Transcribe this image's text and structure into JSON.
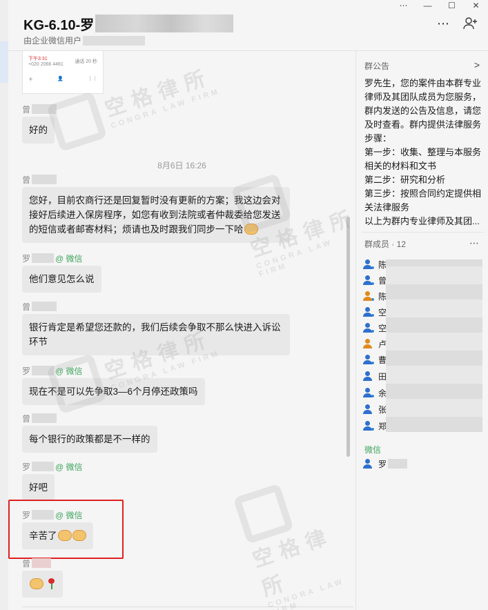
{
  "window": {
    "title": "KG-6.10-罗",
    "subtitle": "由企业微信用户",
    "controls": {
      "more": "⋯",
      "minimize": "—",
      "maximize": "☐",
      "close": "✕"
    }
  },
  "header_icons": {
    "more": "⋯",
    "add_member": "+"
  },
  "chat": {
    "thumbnail": {
      "time": "下午3:31",
      "phone": "+020 2066 4461",
      "duration": "通话 20 秒"
    },
    "date_separator": "8月6日 16:26",
    "messages": [
      {
        "sender": "曾",
        "wechat": "",
        "text": "好的"
      },
      {
        "sender": "曾",
        "wechat": "",
        "text": "您好，目前农商行还是回复暂时没有更新的方案；我这边会对接好后续进入保房程序，如您有收到法院或者仲裁委给您发送的短信或者邮寄材料；烦请也及时跟我们同步一下哈"
      },
      {
        "sender": "罗",
        "wechat": "@ 微信",
        "text": "他们意见怎么说"
      },
      {
        "sender": "曾",
        "wechat": "",
        "text": "银行肯定是希望您还款的，我们后续会争取不那么快进入诉讼环节"
      },
      {
        "sender": "罗",
        "wechat": "@ 微信",
        "text": "现在不是可以先争取3—6个月停还政策吗"
      },
      {
        "sender": "曾",
        "wechat": "",
        "text": "每个银行的政策都是不一样的"
      },
      {
        "sender": "罗",
        "wechat": "@ 微信",
        "text": "好吧"
      },
      {
        "sender": "罗",
        "wechat": "@ 微信",
        "text": "辛苦了"
      },
      {
        "sender": "曾",
        "wechat": "",
        "text": ""
      }
    ]
  },
  "watermark": {
    "cn": "空格律所",
    "en": "CONGRA LAW FIRM"
  },
  "sidebar": {
    "notice_title": "群公告",
    "notice_arrow": ">",
    "notice_text": "罗先生，您的案件由本群专业律师及其团队成员为您服务，群内发送的公告及信息，请您及时查看。群内提供法律服务步骤：\n第一步：收集、整理与本服务相关的材料和文书\n第二步：研究和分析\n第三步：按照合同约定提供相关法律服务\n以上为群内专业律师及其团...",
    "members_title": "群成员 · 12",
    "members_more": "⋯",
    "members": [
      {
        "name": "陈",
        "color": "#2e6fcf"
      },
      {
        "name": "曾",
        "color": "#2e6fcf"
      },
      {
        "name": "陈",
        "color": "#e08a1e"
      },
      {
        "name": "空",
        "color": "#2e6fcf"
      },
      {
        "name": "空",
        "color": "#2e6fcf"
      },
      {
        "name": "卢",
        "color": "#e08a1e"
      },
      {
        "name": "曹",
        "color": "#2e6fcf"
      },
      {
        "name": "田",
        "color": "#2e6fcf"
      },
      {
        "name": "余",
        "color": "#2e6fcf"
      },
      {
        "name": "张",
        "color": "#2e6fcf"
      },
      {
        "name": "郑",
        "color": "#2e6fcf"
      }
    ],
    "wechat_group_title": "微信",
    "wechat_member": {
      "name": "罗",
      "color": "#2e6fcf"
    }
  }
}
